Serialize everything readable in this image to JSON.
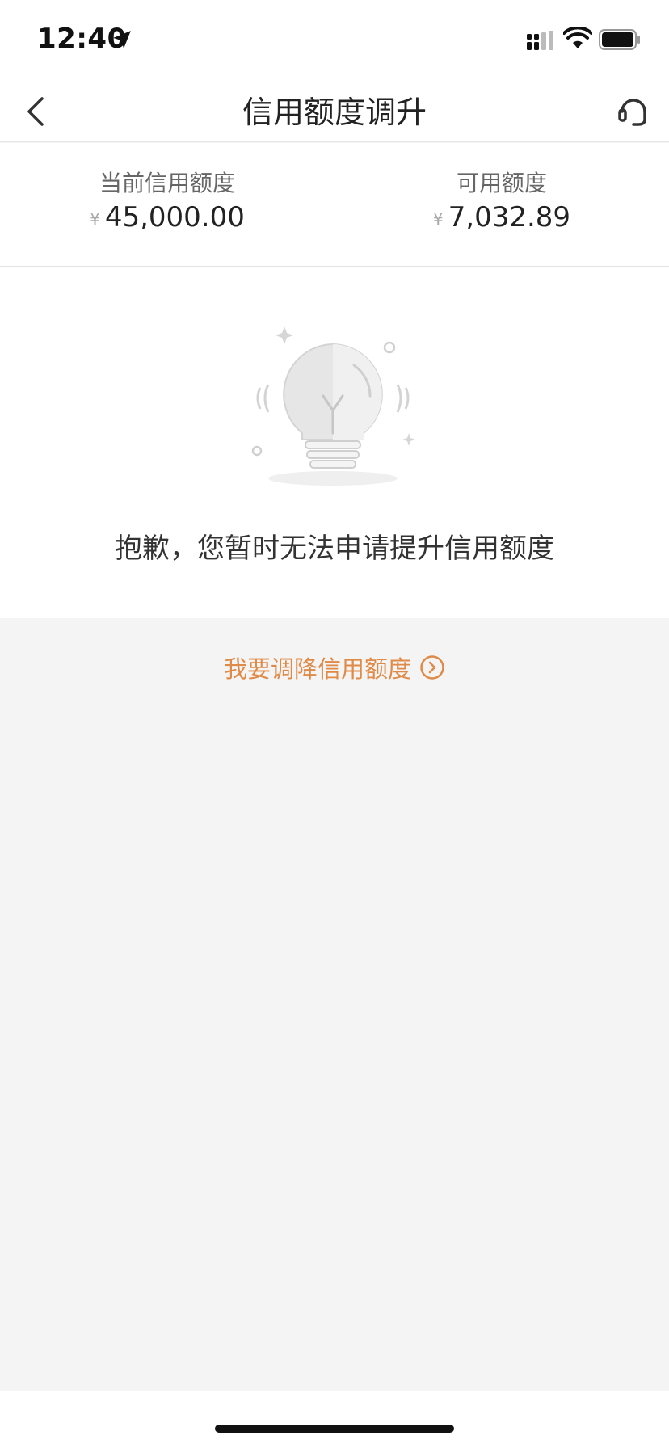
{
  "status_bar": {
    "time": "12:40",
    "icons": [
      "location-arrow-icon",
      "signal-icon",
      "wifi-icon",
      "battery-icon"
    ]
  },
  "nav": {
    "title": "信用额度调升",
    "back_icon": "back-chevron-icon",
    "service_icon": "customer-service-icon"
  },
  "summary": {
    "current": {
      "label": "当前信用额度",
      "currency": "¥",
      "value": "45,000.00"
    },
    "available": {
      "label": "可用额度",
      "currency": "¥",
      "value": "7,032.89"
    }
  },
  "notice": {
    "illustration": "lightbulb-icon",
    "message": "抱歉，您暂时无法申请提升信用额度"
  },
  "link": {
    "label": "我要调降信用额度",
    "icon": "circle-arrow-right-icon"
  },
  "colors": {
    "accent": "#e08a47",
    "background": "#f4f4f4",
    "panel": "#ffffff"
  }
}
